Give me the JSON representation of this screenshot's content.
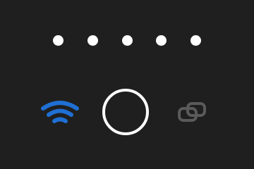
{
  "passcode": {
    "length": 5,
    "dot_color": "#ffffff",
    "dots": [
      {
        "state": "filled"
      },
      {
        "state": "filled"
      },
      {
        "state": "filled"
      },
      {
        "state": "filled"
      },
      {
        "state": "filled"
      }
    ]
  },
  "controls": {
    "left_icon": {
      "name": "wifi-icon",
      "color": "#1f6fd4"
    },
    "center_button": {
      "name": "circle-button",
      "color": "#ffffff"
    },
    "right_icon": {
      "name": "link-icon",
      "color": "#5a5a5a"
    }
  },
  "theme": {
    "background": "#1f1f1f"
  }
}
